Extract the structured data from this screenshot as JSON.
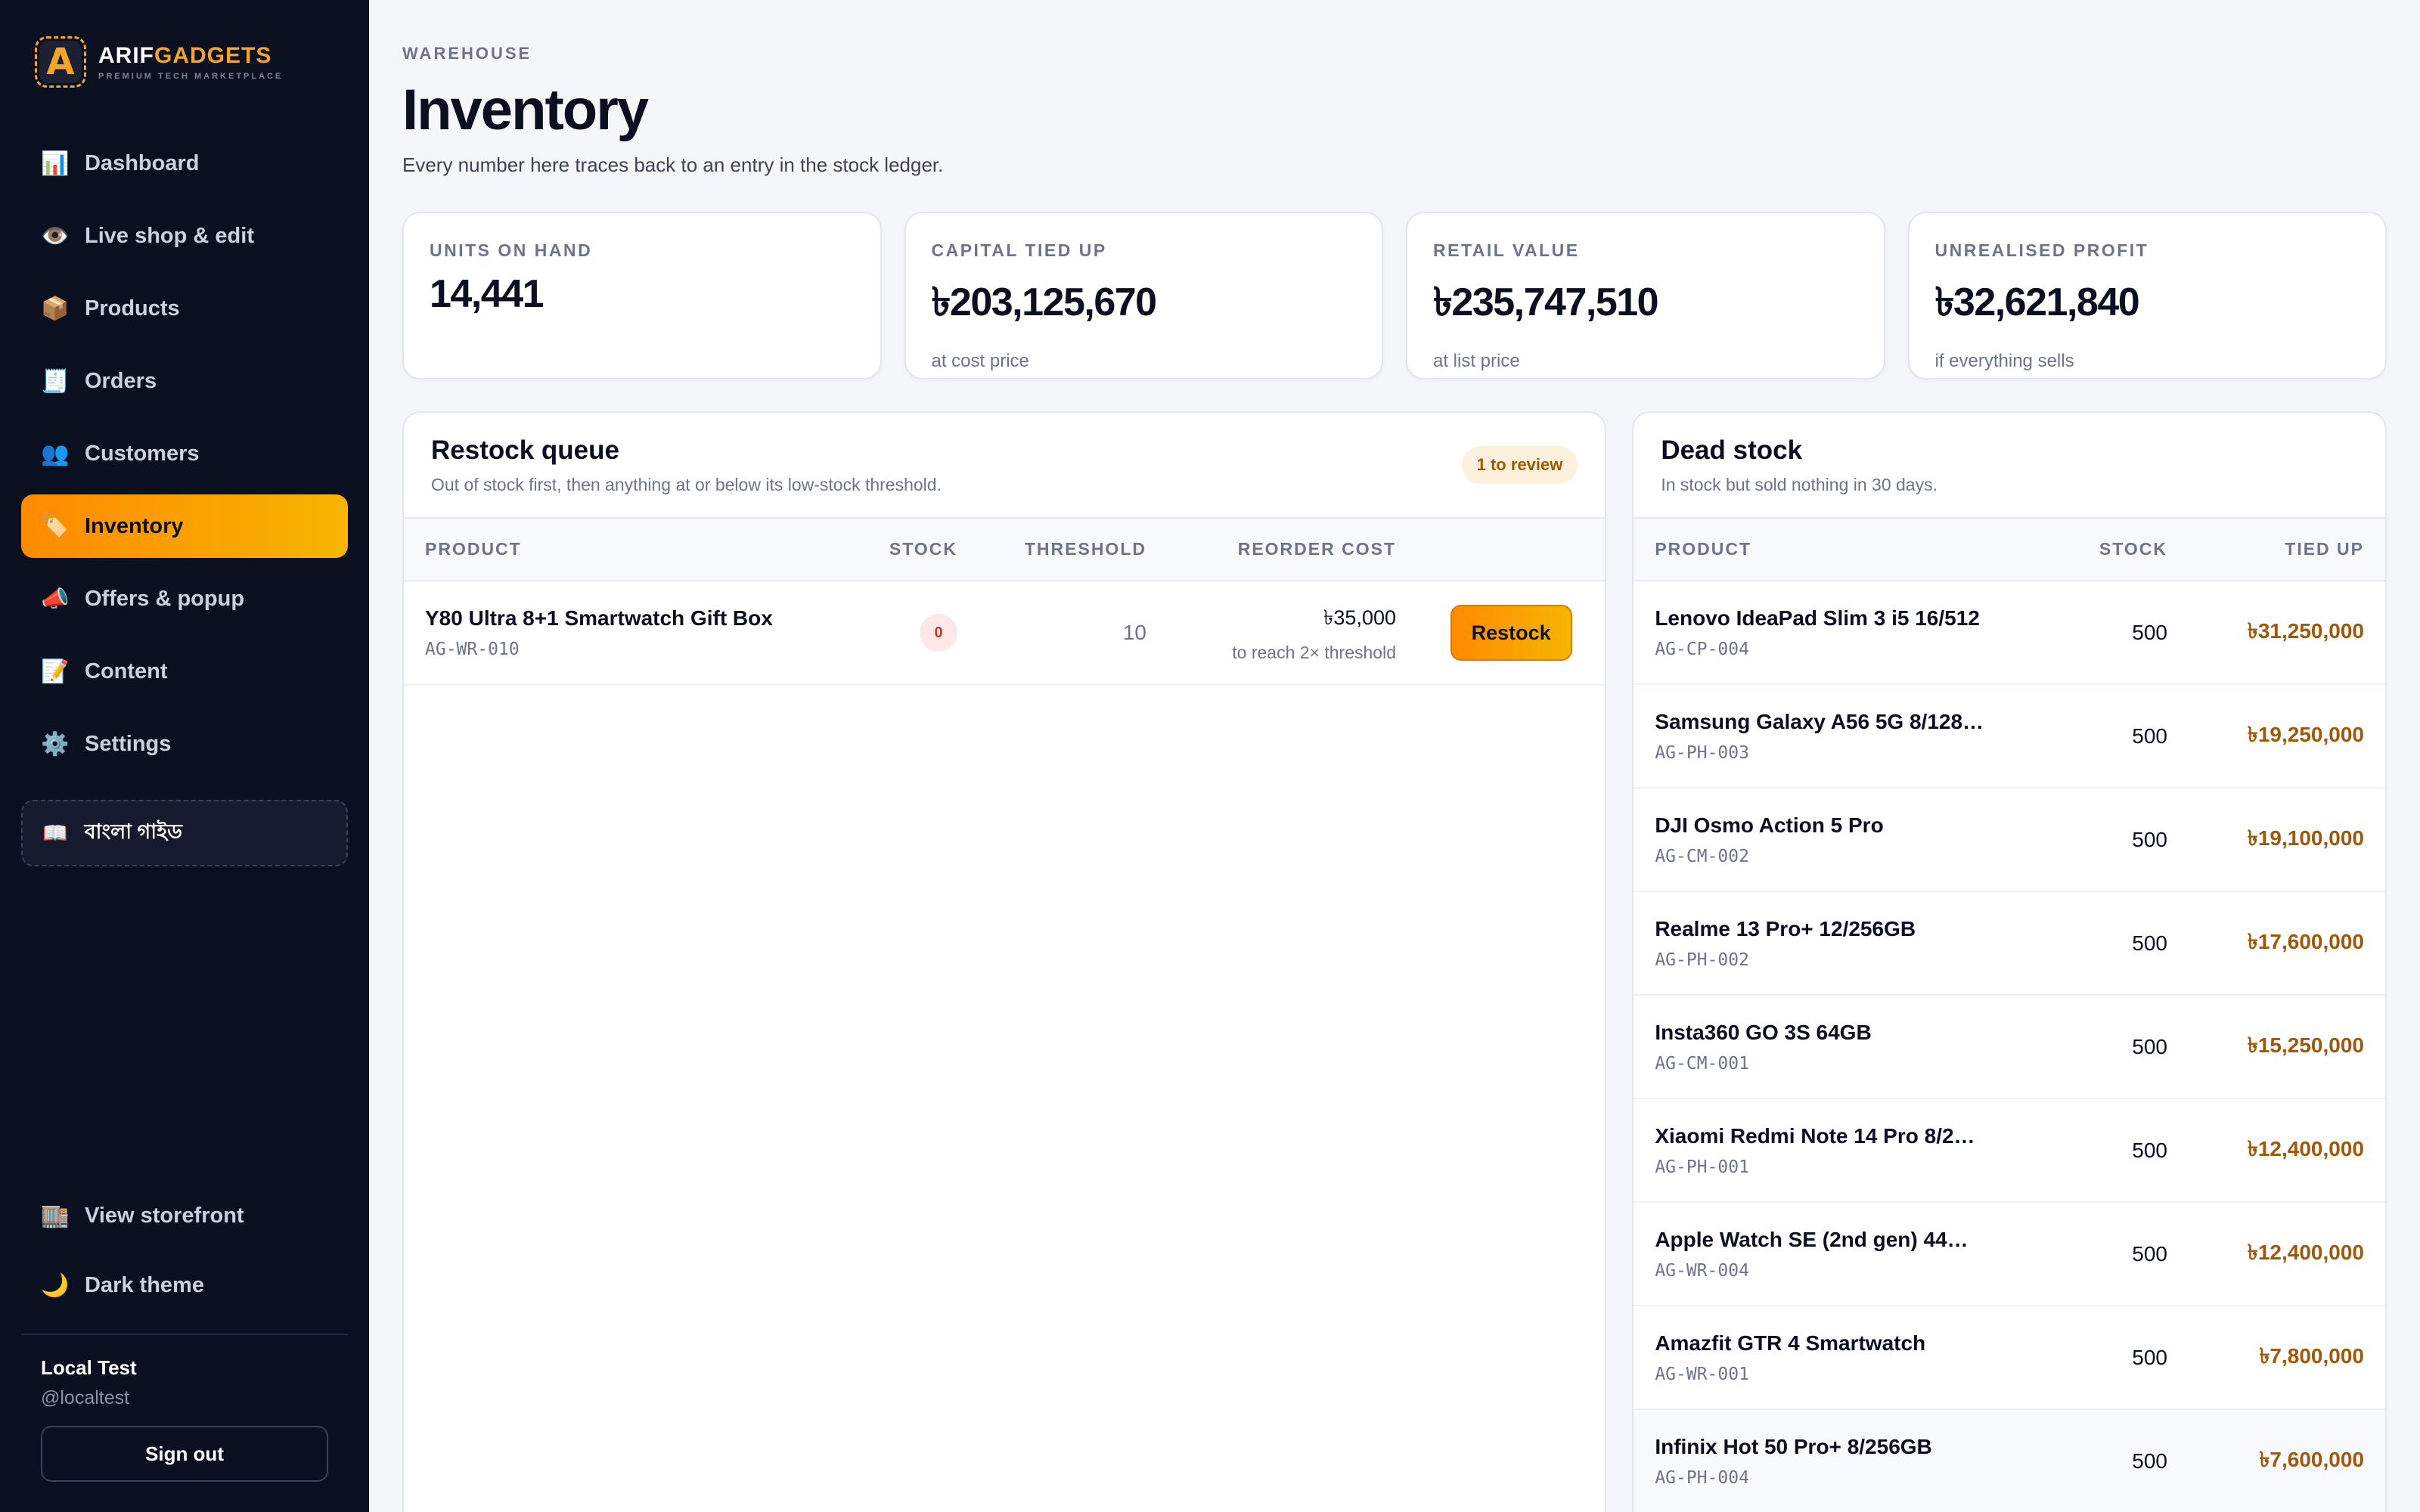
{
  "brand": {
    "name_part1": "ARIF",
    "name_part2": "GADGETS",
    "tagline": "PREMIUM TECH MARKETPLACE",
    "logo_letter": "A"
  },
  "nav": [
    {
      "label": "Dashboard",
      "icon": "📊",
      "icon_name": "chart-icon"
    },
    {
      "label": "Live shop & edit",
      "icon": "👁️",
      "icon_name": "eye-icon"
    },
    {
      "label": "Products",
      "icon": "📦",
      "icon_name": "package-icon"
    },
    {
      "label": "Orders",
      "icon": "🧾",
      "icon_name": "receipt-icon"
    },
    {
      "label": "Customers",
      "icon": "👥",
      "icon_name": "users-icon"
    },
    {
      "label": "Inventory",
      "icon": "🏷️",
      "icon_name": "tag-icon"
    },
    {
      "label": "Offers & popup",
      "icon": "📣",
      "icon_name": "megaphone-icon"
    },
    {
      "label": "Content",
      "icon": "📝",
      "icon_name": "memo-icon"
    },
    {
      "label": "Settings",
      "icon": "⚙️",
      "icon_name": "gear-icon"
    }
  ],
  "guide": {
    "label": "বাংলা গাইড",
    "icon": "📖"
  },
  "bottom_nav": {
    "storefront": {
      "label": "View storefront",
      "icon": "🏬"
    },
    "theme": {
      "label": "Dark theme",
      "icon": "🌙"
    }
  },
  "user": {
    "name": "Local Test",
    "handle": "@localtest",
    "signout": "Sign out"
  },
  "header": {
    "eyebrow": "WAREHOUSE",
    "title": "Inventory",
    "subtitle": "Every number here traces back to an entry in the stock ledger."
  },
  "stats": [
    {
      "label": "UNITS ON HAND",
      "value": "14,441",
      "note": ""
    },
    {
      "label": "CAPITAL TIED UP",
      "value": "৳203,125,670",
      "note": "at cost price"
    },
    {
      "label": "RETAIL VALUE",
      "value": "৳235,747,510",
      "note": "at list price"
    },
    {
      "label": "UNREALISED PROFIT",
      "value": "৳32,621,840",
      "note": "if everything sells"
    }
  ],
  "restock": {
    "title": "Restock queue",
    "subtitle": "Out of stock first, then anything at or below its low-stock threshold.",
    "badge": "1 to review",
    "columns": {
      "product": "PRODUCT",
      "stock": "STOCK",
      "threshold": "THRESHOLD",
      "cost": "REORDER COST"
    },
    "rows": [
      {
        "name": "Y80 Ultra 8+1 Smartwatch Gift Box",
        "sku": "AG-WR-010",
        "stock": "0",
        "threshold": "10",
        "cost": "৳35,000",
        "cost_note": "to reach 2× threshold",
        "action": "Restock"
      }
    ]
  },
  "dead": {
    "title": "Dead stock",
    "subtitle": "In stock but sold nothing in 30 days.",
    "columns": {
      "product": "PRODUCT",
      "stock": "STOCK",
      "tied": "TIED UP"
    },
    "rows": [
      {
        "name": "Lenovo IdeaPad Slim 3 i5 16/512",
        "sku": "AG-CP-004",
        "stock": "500",
        "tied": "৳31,250,000"
      },
      {
        "name": "Samsung Galaxy A56 5G 8/128…",
        "sku": "AG-PH-003",
        "stock": "500",
        "tied": "৳19,250,000"
      },
      {
        "name": "DJI Osmo Action 5 Pro",
        "sku": "AG-CM-002",
        "stock": "500",
        "tied": "৳19,100,000"
      },
      {
        "name": "Realme 13 Pro+ 12/256GB",
        "sku": "AG-PH-002",
        "stock": "500",
        "tied": "৳17,600,000"
      },
      {
        "name": "Insta360 GO 3S 64GB",
        "sku": "AG-CM-001",
        "stock": "500",
        "tied": "৳15,250,000"
      },
      {
        "name": "Xiaomi Redmi Note 14 Pro 8/2…",
        "sku": "AG-PH-001",
        "stock": "500",
        "tied": "৳12,400,000"
      },
      {
        "name": "Apple Watch SE (2nd gen) 44…",
        "sku": "AG-WR-004",
        "stock": "500",
        "tied": "৳12,400,000"
      },
      {
        "name": "Amazfit GTR 4 Smartwatch",
        "sku": "AG-WR-001",
        "stock": "500",
        "tied": "৳7,800,000"
      },
      {
        "name": "Infinix Hot 50 Pro+ 8/256GB",
        "sku": "AG-PH-004",
        "stock": "500",
        "tied": "৳7,600,000"
      }
    ]
  },
  "colors": {
    "accent_start": "#ff8a00",
    "accent_end": "#f7b500",
    "sidebar_bg": "#0b1020",
    "tied_up": "#a0580a"
  }
}
